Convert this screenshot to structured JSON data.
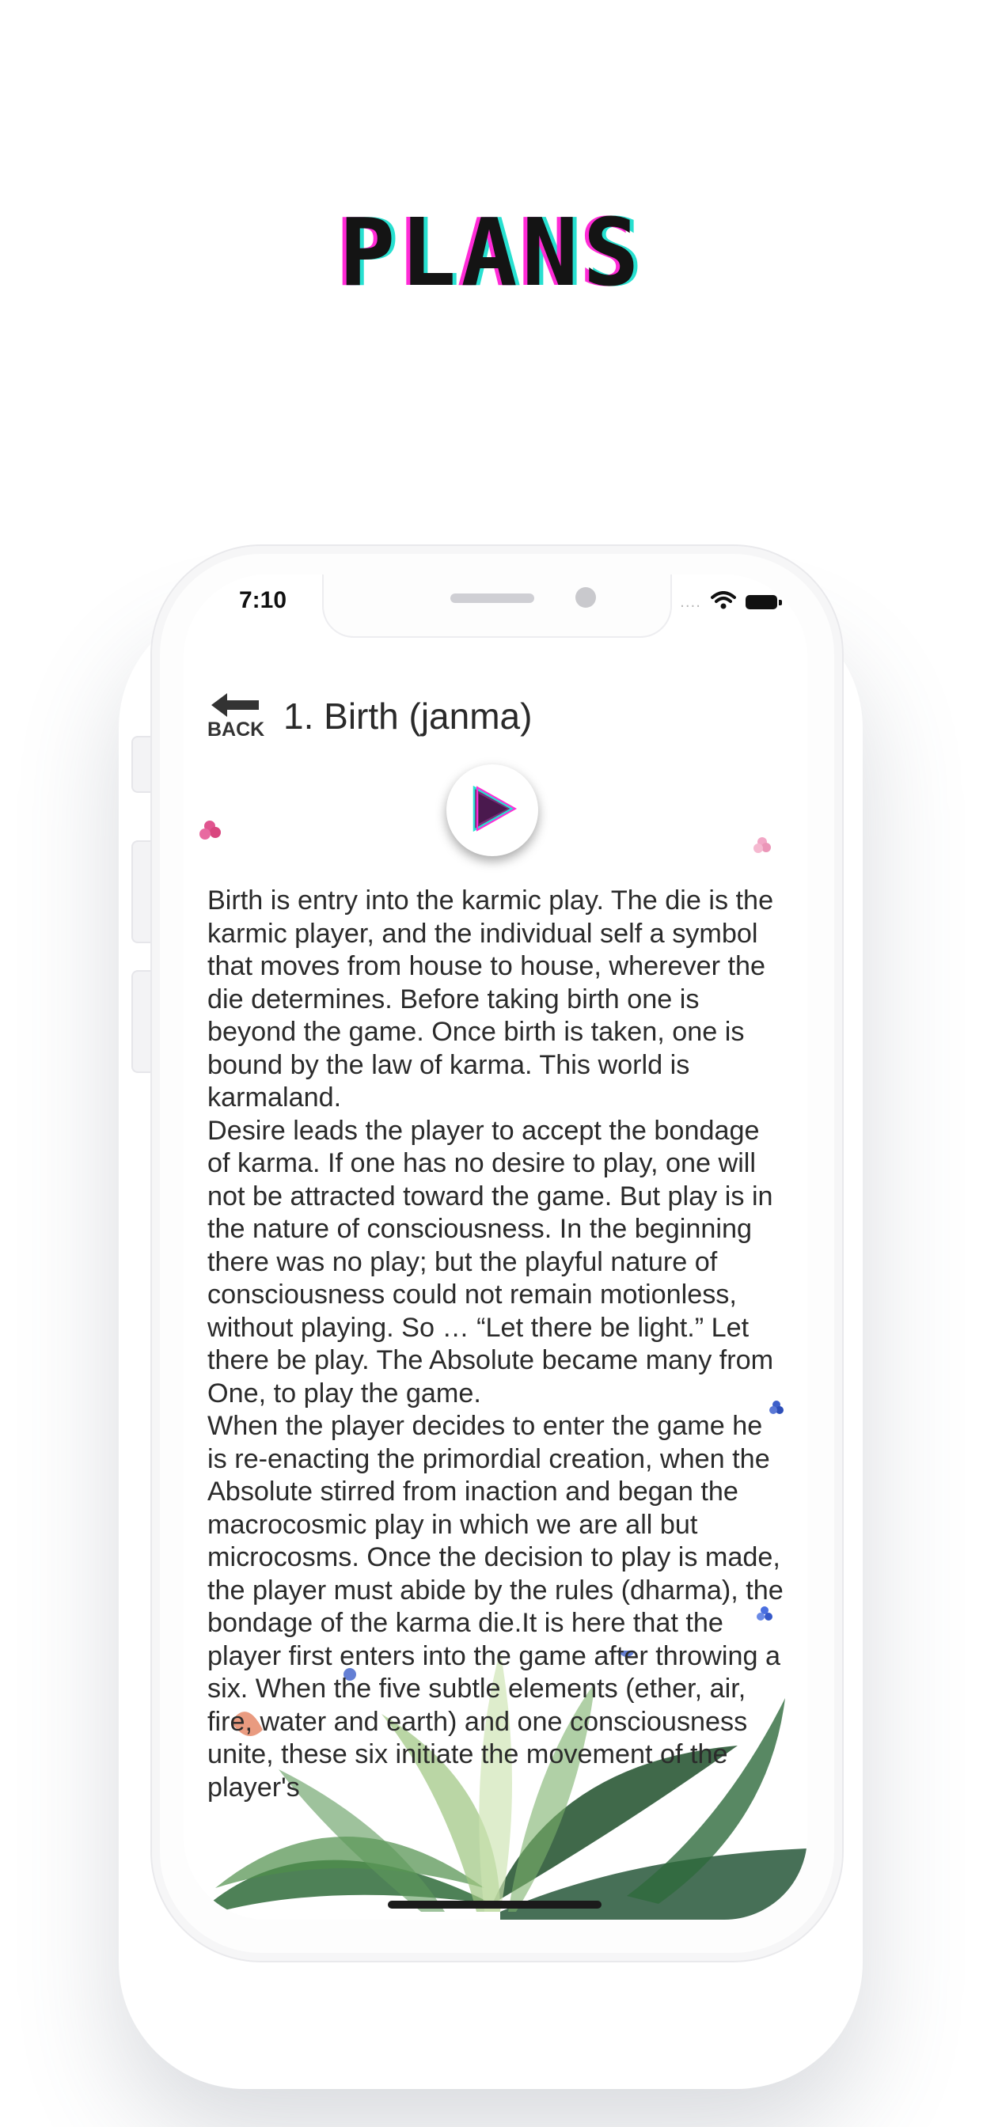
{
  "promo": {
    "title": "PLANS"
  },
  "status_bar": {
    "time": "7:10",
    "signal_text": "....",
    "icons": [
      "wifi-icon",
      "battery-icon"
    ]
  },
  "header": {
    "back_label": "BACK",
    "title": "1. Birth (janma)"
  },
  "player": {
    "icon": "play-icon"
  },
  "story": {
    "paragraphs": [
      "Birth is entry into the karmic play. The die is the karmic player, and the individual self a symbol that moves from house to house, wherever the die determines. Before taking birth one is beyond the game. Once birth is taken, one is bound by the law of karma. This world is karmaland.",
      "Desire leads the player to accept the bondage of karma. If one has no desire to play, one will not be attracted toward the game. But play is in the nature of consciousness. In the beginning there was no play; but the playful nature of consciousness could not remain motionless, without playing. So … “Let there be light.” Let there be play. The Absolute became many from One, to play the game.",
      "When the player decides to enter the game he is re-enacting the primordial creation, when the Absolute stirred from inaction and began the macrocosmic play in which we are all but microcosms. Once the decision to play is made, the player must abide by the rules (dharma), the bondage of the karma die.It is here that the player first enters into the game after throwing a six. When the five subtle elements (ether, air, fire, water and earth) and one consciousness unite, these six initiate the movement of the player's"
    ]
  },
  "colors": {
    "title_glitch_magenta": "#ff2bd6",
    "title_glitch_cyan": "#27e0d0",
    "play_icon_fill": "#7a2b7a",
    "text": "#2b2b2b"
  }
}
